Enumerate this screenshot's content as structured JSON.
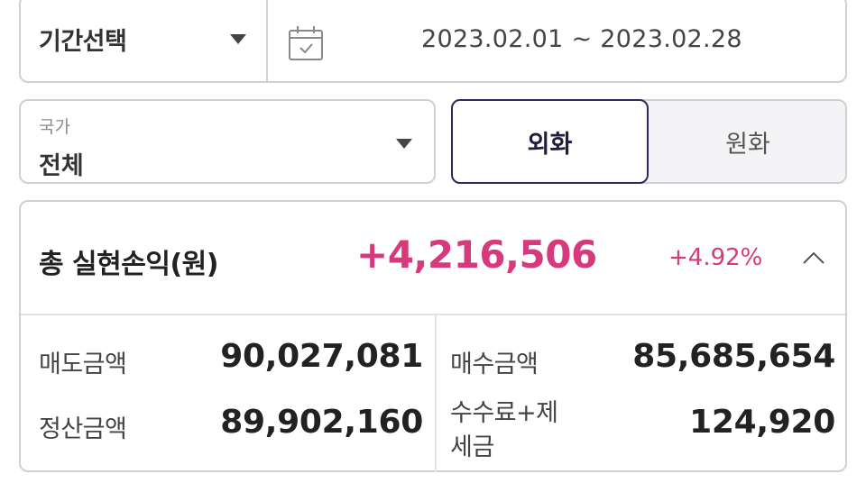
{
  "period": {
    "select_label": "기간선택",
    "range_text": "2023.02.01 ~ 2023.02.28"
  },
  "country": {
    "caption": "국가",
    "value": "전체"
  },
  "currency": {
    "options": [
      "외화",
      "원화"
    ],
    "selected": "외화"
  },
  "profit": {
    "title": "총 실현손익(원)",
    "amount": "+4,216,506",
    "percent": "+4.92%",
    "rows": {
      "sell_amount_label": "매도금액",
      "sell_amount_value": "90,027,081",
      "buy_amount_label": "매수금액",
      "buy_amount_value": "85,685,654",
      "settle_amount_label": "정산금액",
      "settle_amount_value": "89,902,160",
      "fee_tax_label_line1": "수수료+제",
      "fee_tax_label_line2": "세금",
      "fee_tax_value": "124,920"
    }
  },
  "colors": {
    "accent_profit": "#d63a7c",
    "selected_border": "#2b2b5a",
    "border": "#cfcfd4"
  },
  "icons": [
    "chevron-down-icon",
    "calendar-icon",
    "chevron-up-icon"
  ]
}
